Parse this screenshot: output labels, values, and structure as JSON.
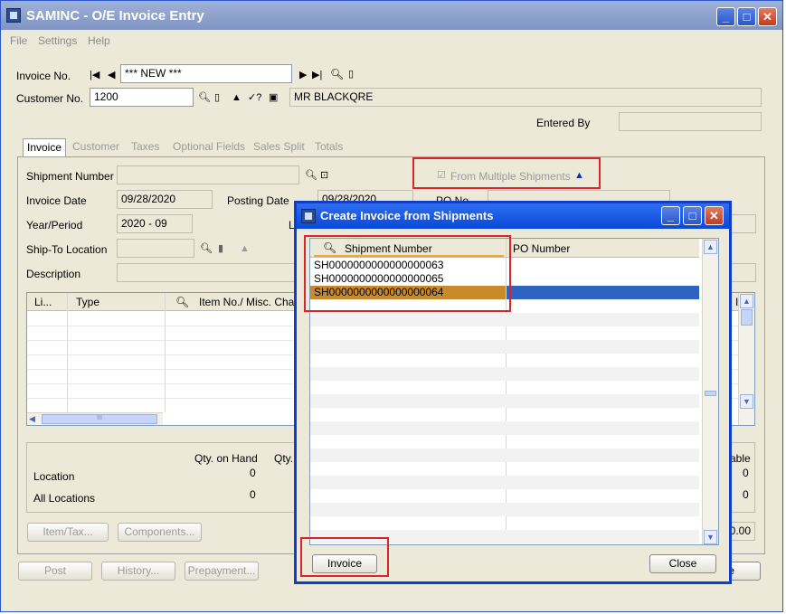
{
  "window": {
    "title": "SAMINC - O/E Invoice Entry"
  },
  "menu": [
    "File",
    "Settings",
    "Help"
  ],
  "header": {
    "invoice_no_label": "Invoice No.",
    "invoice_no_value": "*** NEW ***",
    "customer_no_label": "Customer No.",
    "customer_no_value": "1200",
    "customer_name": "MR BLACKQRE",
    "entered_by_label": "Entered By",
    "entered_by_value": ""
  },
  "tabs": [
    "Invoice",
    "Customer",
    "Taxes",
    "Optional Fields",
    "Sales Split",
    "Totals"
  ],
  "invoice_tab": {
    "shipment_number_label": "Shipment Number",
    "shipment_number_value": "",
    "from_multiple_label": "From Multiple Shipments",
    "invoice_date_label": "Invoice Date",
    "invoice_date_value": "09/28/2020",
    "posting_date_label": "Posting Date",
    "posting_date_value": "09/28/2020",
    "po_no_label": "PO No.",
    "year_period_label": "Year/Period",
    "year_period_value": "2020 - 09",
    "ship_to_label": "Ship-To Location",
    "description_label": "Description",
    "grid_headers": [
      "Li...",
      "Type",
      "Item No./ Misc. Char"
    ],
    "grid_right_header": "I",
    "qty_on_hand_label": "Qty. on Hand",
    "qty_label": "Qty.",
    "location_label": "Location",
    "location_qty": "0",
    "all_locations_label": "All Locations",
    "all_locations_qty": "0",
    "available_label": "able",
    "available_location_qty": "0",
    "available_all_qty": "0",
    "total_value": "0.00",
    "item_tax_button": "Item/Tax...",
    "components_button": "Components...",
    "post_button": "Post",
    "history_button": "History...",
    "prepayment_button": "Prepayment...",
    "close_partial": "e"
  },
  "dialog": {
    "title": "Create Invoice from Shipments",
    "col_shipment": "Shipment Number",
    "col_po": "PO Number",
    "rows": [
      {
        "shipment": "SH0000000000000000063",
        "po": ""
      },
      {
        "shipment": "SH0000000000000000065",
        "po": ""
      },
      {
        "shipment": "SH0000000000000000064",
        "po": ""
      }
    ],
    "invoice_button": "Invoice",
    "close_button": "Close"
  },
  "colors": {
    "highlight": "#c98a2b",
    "selection": "#2f63c2",
    "annotation": "#d8252a"
  }
}
